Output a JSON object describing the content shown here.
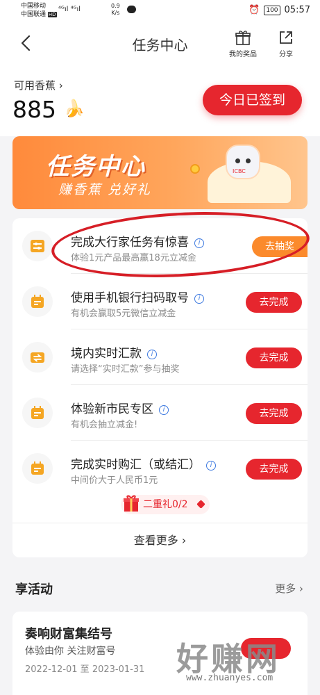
{
  "status_bar": {
    "carrier1": "中国移动",
    "carrier2": "中国联通",
    "hd": "HD",
    "signal": "⁴ᴳıl ⁴ᴳıl",
    "speed_value": "0.9",
    "speed_unit": "K/s",
    "battery": "100",
    "time": "05:57"
  },
  "nav": {
    "title": "任务中心",
    "my_prizes_label": "我的奖品",
    "share_label": "分享"
  },
  "balance": {
    "label": "可用香蕉",
    "value": "885"
  },
  "checkin_label": "今日已签到",
  "banner": {
    "title": "任务中心",
    "subtitle": "赚香蕉 兑好礼",
    "brand": "ICBC"
  },
  "tasks": [
    {
      "title": "完成大行家任务有惊喜",
      "subtitle": "体验1元产品最高赢18元立减金",
      "button": "去抽奖",
      "icon": "sliders-icon"
    },
    {
      "title": "使用手机银行扫码取号",
      "subtitle": "有机会赢取5元微信立减金",
      "button": "去完成",
      "icon": "calendar-icon"
    },
    {
      "title": "境内实时汇款",
      "subtitle": "请选择“实时汇款”参与抽奖",
      "button": "去完成",
      "icon": "transfer-icon"
    },
    {
      "title": "体验新市民专区",
      "subtitle": "有机会抽立减金!",
      "button": "去完成",
      "icon": "calendar-icon"
    },
    {
      "title": "完成实时购汇（或结汇）",
      "subtitle": "中间价大于人民币1元",
      "button": "去完成",
      "icon": "calendar-icon"
    }
  ],
  "gift": {
    "label": "二重礼0/2"
  },
  "view_more": "查看更多",
  "activities": {
    "title": "享活动",
    "more": "更多",
    "card": {
      "title": "奏响财富集结号",
      "subtitle": "体验由你 关注财富号",
      "date": "2022-12-01 至 2023-01-31"
    }
  },
  "watermark": {
    "main": "好赚网",
    "url": "www.zhuanyes.com"
  },
  "colors": {
    "primary_red": "#e6262e",
    "orange": "#fb8a2c",
    "icon_orange": "#f5a623"
  }
}
